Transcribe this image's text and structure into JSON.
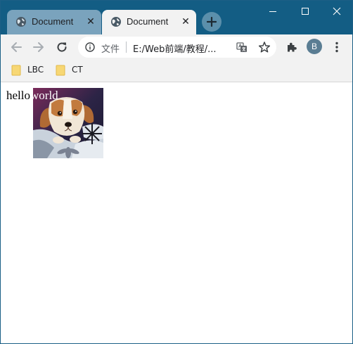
{
  "tabs": [
    {
      "title": "Document",
      "active": false,
      "favicon": "globe-icon",
      "close": "✕"
    },
    {
      "title": "Document",
      "active": true,
      "favicon": "globe-icon",
      "close": "✕"
    }
  ],
  "toolbar": {
    "scheme_label": "文件",
    "url": "E:/Web前端/教程/...",
    "avatar_initial": "B"
  },
  "bookmarks": [
    {
      "label": "LBC",
      "icon": "folder-icon"
    },
    {
      "label": "CT",
      "icon": "folder-icon"
    }
  ],
  "content": {
    "text_before": "hello",
    "text_after": "world",
    "image_subject": "puppy"
  },
  "colors": {
    "frame": "#135d84",
    "tab_inactive": "#7aa3bd",
    "toolbar_bg": "#f2f2f2",
    "avatar": "#5a7d93"
  }
}
